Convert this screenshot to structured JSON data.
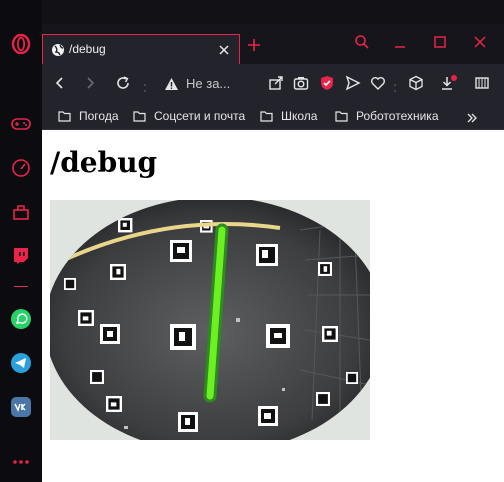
{
  "tab": {
    "title": "/debug"
  },
  "address": {
    "security_text": "Не за..."
  },
  "bookmarks": [
    {
      "label": "Погода"
    },
    {
      "label": "Соцсети и почта"
    },
    {
      "label": "Школа"
    },
    {
      "label": "Робототехника"
    }
  ],
  "page": {
    "heading": "/debug"
  },
  "colors": {
    "accent": "#e8244a",
    "detection_line": "#6cf020",
    "detection_outline": "#2e8b22",
    "curve": "#e9d68a"
  },
  "icons": {
    "sidebar": [
      "opera-logo-icon",
      "gamepad-icon",
      "speedometer-icon",
      "bag-icon",
      "twitch-icon",
      "whatsapp-icon",
      "telegram-icon",
      "vk-icon",
      "more-icon"
    ],
    "toolbar": [
      "back-icon",
      "forward-icon",
      "reload-icon",
      "warning-icon",
      "share-icon",
      "camera-icon",
      "shield-icon",
      "send-icon",
      "heart-icon",
      "box-icon",
      "download-icon",
      "extensions-icon"
    ]
  }
}
